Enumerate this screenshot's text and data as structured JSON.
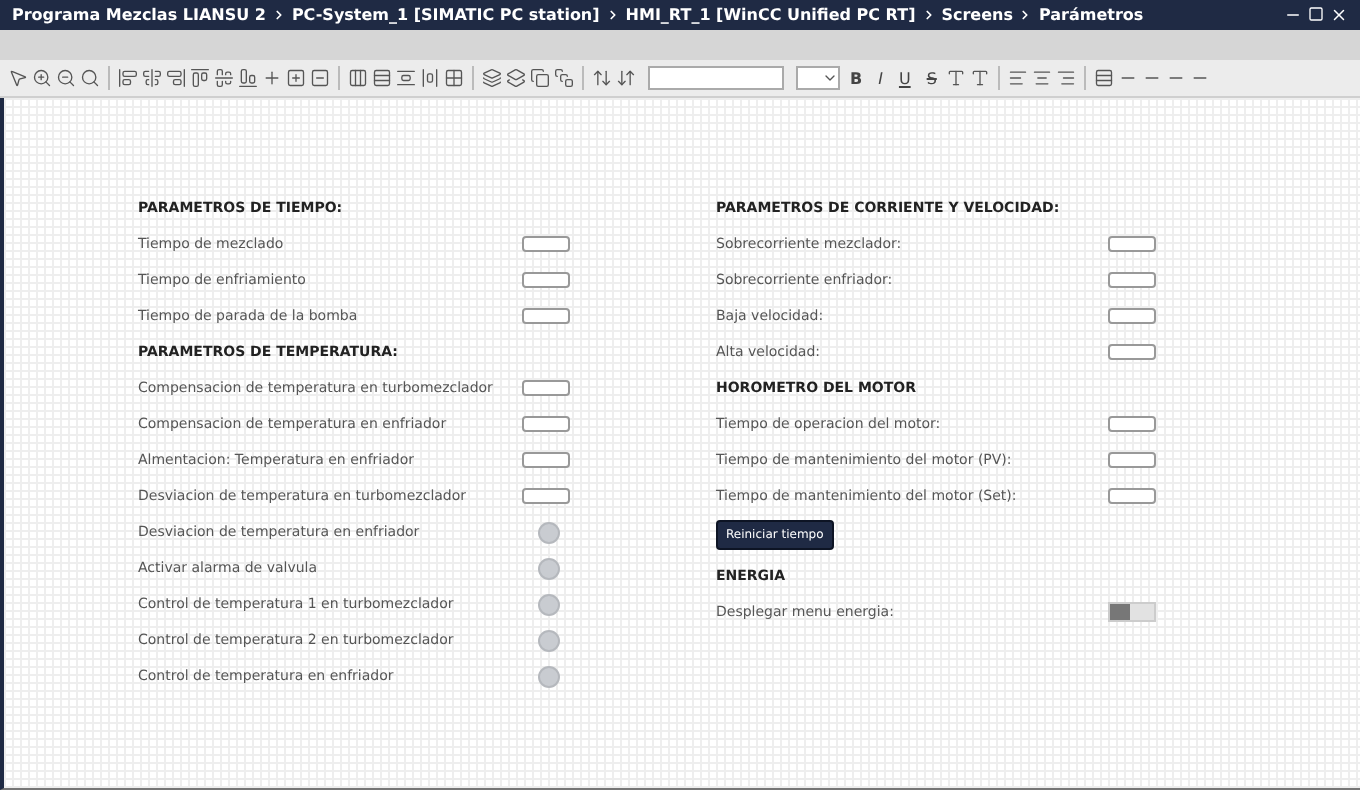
{
  "title_bar": {
    "breadcrumb": [
      "Programa Mezclas LIANSU 2",
      "PC-System_1 [SIMATIC PC station]",
      "HMI_RT_1 [WinCC Unified PC RT]",
      "Screens",
      "Parámetros"
    ]
  },
  "toolbar": {
    "text_buttons": [
      "B",
      "I",
      "U",
      "S"
    ]
  },
  "columns": [
    {
      "sections": [
        {
          "title": "PARAMETROS DE TIEMPO:",
          "items": [
            {
              "kind": "field",
              "label": "Tiempo de mezclado"
            },
            {
              "kind": "field",
              "label": "Tiempo de enfriamiento"
            },
            {
              "kind": "field",
              "label": "Tiempo de parada de la bomba"
            }
          ]
        },
        {
          "title": "PARAMETROS DE TEMPERATURA:",
          "items": [
            {
              "kind": "field",
              "label": "Compensacion de temperatura en turbomezclador"
            },
            {
              "kind": "field",
              "label": "Compensacion de temperatura en enfriador"
            },
            {
              "kind": "field",
              "label": "Almentacion: Temperatura en enfriador"
            },
            {
              "kind": "field",
              "label": "Desviacion de temperatura en turbomezclador"
            },
            {
              "kind": "indicator",
              "label": "Desviacion de temperatura en enfriador"
            },
            {
              "kind": "indicator",
              "label": "Activar alarma de valvula"
            },
            {
              "kind": "indicator",
              "label": "Control de temperatura 1 en turbomezclador"
            },
            {
              "kind": "indicator",
              "label": "Control de temperatura 2 en turbomezclador"
            },
            {
              "kind": "indicator",
              "label": "Control de temperatura en enfriador"
            }
          ]
        }
      ]
    },
    {
      "sections": [
        {
          "title": "PARAMETROS DE CORRIENTE Y VELOCIDAD:",
          "items": [
            {
              "kind": "field",
              "label": "Sobrecorriente mezclador:"
            },
            {
              "kind": "field",
              "label": "Sobrecorriente enfriador:"
            },
            {
              "kind": "field",
              "label": "Baja velocidad:"
            },
            {
              "kind": "field",
              "label": "Alta velocidad:"
            }
          ]
        },
        {
          "title": "HOROMETRO DEL MOTOR",
          "items": [
            {
              "kind": "field",
              "label": "Tiempo de operacion del motor:"
            },
            {
              "kind": "field",
              "label": "Tiempo de mantenimiento del motor (PV):"
            },
            {
              "kind": "field",
              "label": "Tiempo de mantenimiento del motor (Set):"
            },
            {
              "kind": "button",
              "label": "Reiniciar tiempo"
            }
          ]
        },
        {
          "title": "ENERGIA",
          "items": [
            {
              "kind": "switch",
              "label": "Desplegar menu energia:",
              "on": false
            }
          ]
        }
      ]
    }
  ]
}
